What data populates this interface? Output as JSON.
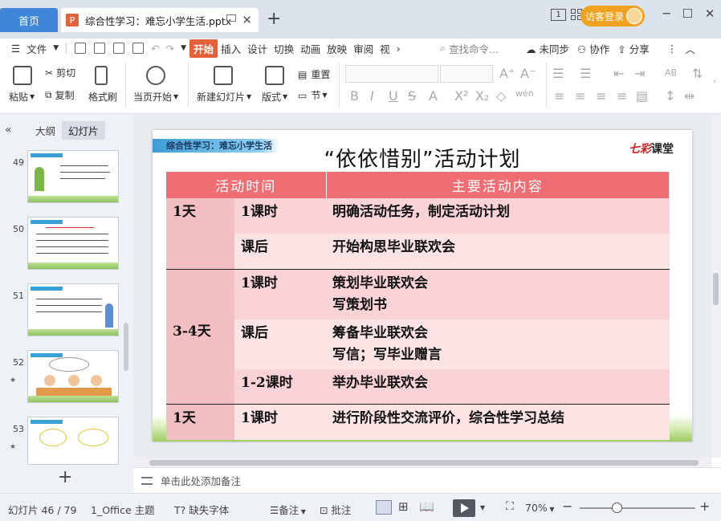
{
  "titlebar": {
    "home_tab": "首页",
    "doc_tab_icon": "P",
    "doc_tab": "综合性学习：难忘小学生活.pptx",
    "new_tab": "+",
    "badge": "1",
    "login": "访客登录",
    "close_icon": "close-icon"
  },
  "menubar": {
    "file": "文件",
    "tabs": [
      "开始",
      "插入",
      "设计",
      "切换",
      "动画",
      "放映",
      "审阅",
      "视"
    ],
    "search": "查找命令...",
    "sync": "未同步",
    "collab": "协作",
    "share": "分享"
  },
  "ribbon": {
    "paste": "粘贴",
    "cut": "剪切",
    "copy": "复制",
    "format_painter": "格式刷",
    "from_start": "当页开始",
    "new_slide": "新建幻灯片",
    "layout": "版式",
    "reset": "重置",
    "section": "节"
  },
  "left_panel": {
    "outline_tab": "大纲",
    "slides_tab": "幻灯片",
    "slide_numbers": [
      "49",
      "50",
      "51",
      "52",
      "53"
    ],
    "add": "+"
  },
  "slide": {
    "tag": "综合性学习：难忘小学生活",
    "title": "“依依惜别”活动计划",
    "logo_red": "七彩",
    "logo_black": "课堂",
    "table": {
      "headers": [
        "活动时间",
        "主要活动内容"
      ],
      "rows": [
        {
          "day": "1天",
          "period": "1课时",
          "lines": [
            "明确活动任务，制定活动计划"
          ]
        },
        {
          "day": "",
          "period": "课后",
          "lines": [
            "开始构思毕业联欢会"
          ]
        },
        {
          "day": "",
          "period": "1课时",
          "lines": [
            "策划毕业联欢会",
            "写策划书"
          ]
        },
        {
          "day": "3-4天",
          "period": "课后",
          "lines": [
            "筹备毕业联欢会",
            "写信；写毕业赠言"
          ]
        },
        {
          "day": "",
          "period": "1-2课时",
          "lines": [
            "举办毕业联欢会"
          ]
        },
        {
          "day": "1天",
          "period": "1课时",
          "lines": [
            "进行阶段性交流评价，综合性学习总结"
          ]
        }
      ]
    }
  },
  "notes": {
    "placeholder": "单击此处添加备注"
  },
  "status": {
    "slide_count": "幻灯片 46 / 79",
    "theme": "1_Office 主题",
    "missing_font": "缺失字体",
    "notes": "备注",
    "comments": "批注",
    "zoom": "70%"
  },
  "colors": {
    "accent": "#e2623b",
    "table_header": "#ef6e73",
    "home_tab": "#3f86d8",
    "login": "#f0a323"
  }
}
